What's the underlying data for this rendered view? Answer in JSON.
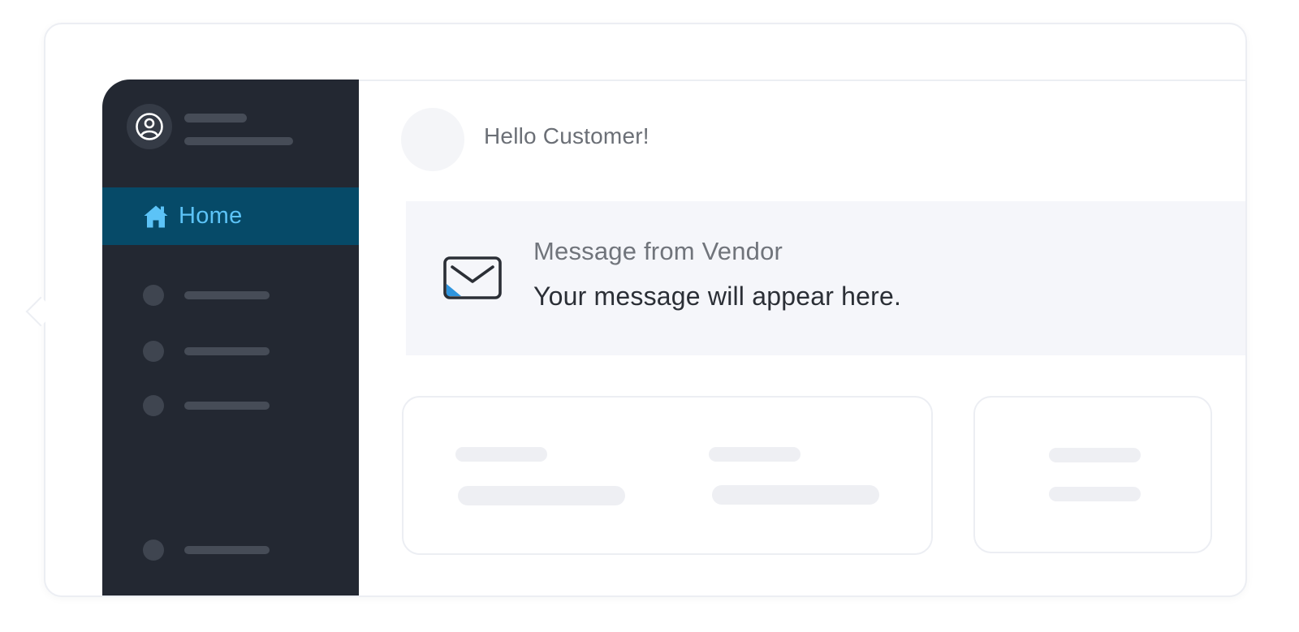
{
  "sidebar": {
    "nav": [
      {
        "label": "Home",
        "icon": "home-icon",
        "active": true
      }
    ]
  },
  "main": {
    "greeting": "Hello Customer!",
    "message": {
      "title": "Message from Vendor",
      "body": "Your message will appear here.",
      "icon": "envelope-icon"
    }
  },
  "colors": {
    "sidebar_bg": "#232832",
    "active_bg": "#064a68",
    "active_text": "#5cc3f7",
    "message_bg": "#f5f6fa"
  }
}
